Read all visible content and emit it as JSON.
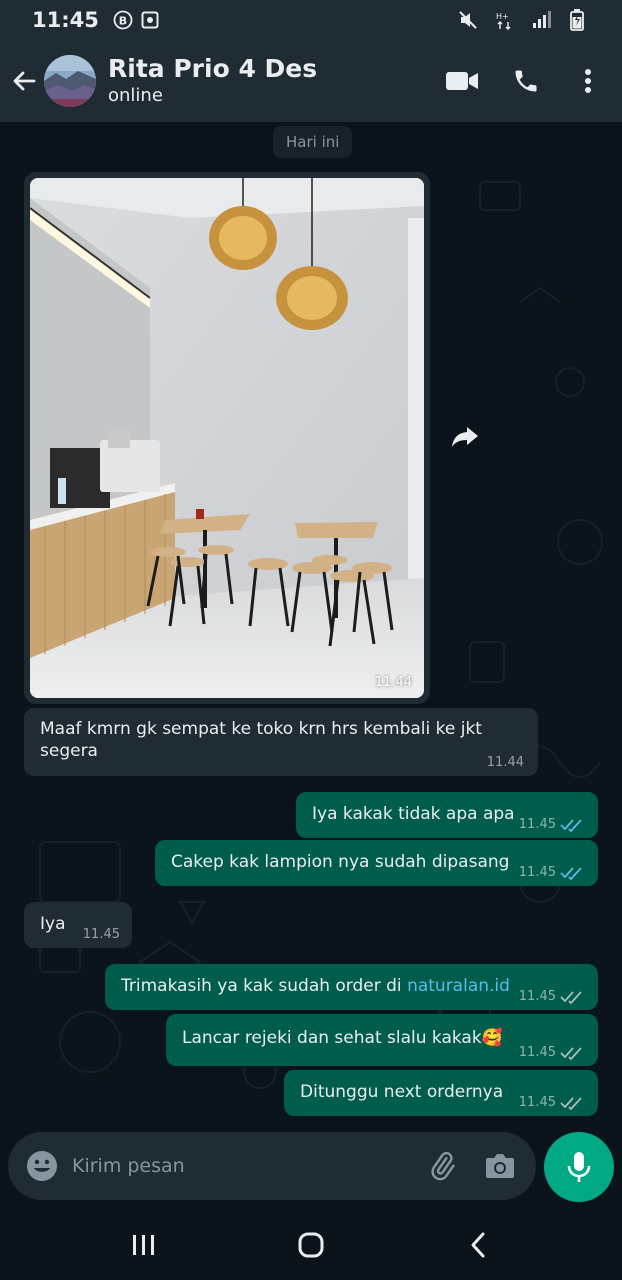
{
  "status_bar": {
    "time": "11:45",
    "icons": [
      "b-badge-icon",
      "gallery-icon",
      "mute-icon",
      "hd-signal-icon",
      "signal-icon",
      "battery-charging-icon"
    ]
  },
  "header": {
    "contact_name": "Rita Prio 4 Des",
    "contact_status": "online",
    "icons": [
      "back-arrow-icon",
      "video-call-icon",
      "voice-call-icon",
      "more-options-icon"
    ]
  },
  "chat": {
    "date_chip": "Hari ini",
    "messages": [
      {
        "direction": "in",
        "type": "image",
        "time": "11.44"
      },
      {
        "direction": "in",
        "text": "Maaf kmrn gk sempat ke toko krn hrs kembali ke jkt segera",
        "time": "11.44"
      },
      {
        "direction": "out",
        "text": "Iya kakak tidak apa apa",
        "time": "11.45",
        "status": "read"
      },
      {
        "direction": "out",
        "text": "Cakep kak lampion nya sudah dipasang",
        "time": "11.45",
        "status": "read"
      },
      {
        "direction": "in",
        "text": "Iya",
        "time": "11.45"
      },
      {
        "direction": "out",
        "text_before_link": "Trimakasih ya kak sudah order di ",
        "link": "naturalan.id",
        "time": "11.45",
        "status": "delivered"
      },
      {
        "direction": "out",
        "text": "Lancar rejeki dan sehat slalu kakak",
        "emoji": "🥰",
        "time": "11.45",
        "status": "delivered"
      },
      {
        "direction": "out",
        "text": "Ditunggu next ordernya",
        "time": "11.45",
        "status": "delivered"
      }
    ]
  },
  "composer": {
    "placeholder": "Kirim pesan",
    "icons": [
      "emoji-icon",
      "attach-icon",
      "camera-icon",
      "mic-icon"
    ]
  },
  "colors": {
    "header_bg": "#202c33",
    "chat_bg": "#0b141a",
    "incoming_bubble": "#202c33",
    "outgoing_bubble": "#005c4b",
    "accent": "#00a884",
    "read_tick": "#53bdeb",
    "link": "#53bdeb"
  }
}
